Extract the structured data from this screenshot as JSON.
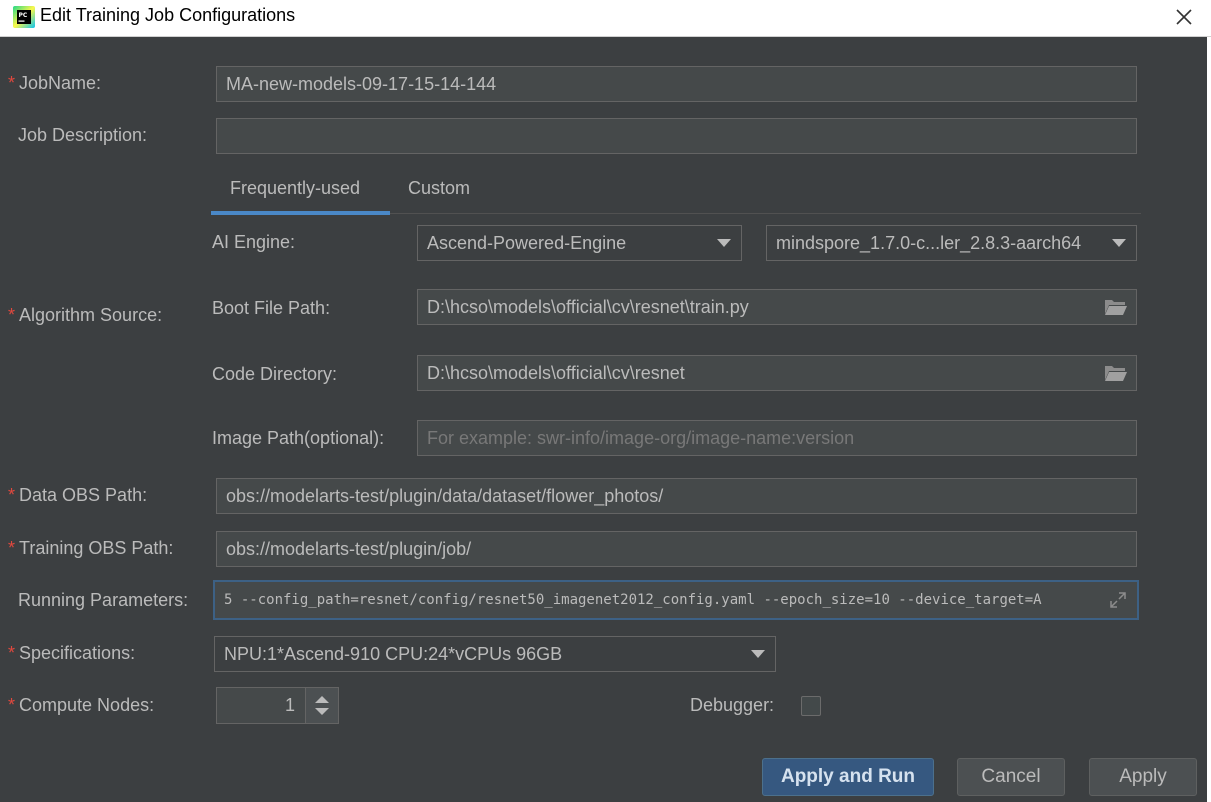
{
  "window": {
    "title": "Edit Training Job Configurations"
  },
  "form": {
    "jobname_label": "JobName:",
    "jobname_value": "MA-new-models-09-17-15-14-144",
    "job_description_label": "Job Description:",
    "job_description_value": "",
    "tabs": [
      {
        "label": "Frequently-used"
      },
      {
        "label": "Custom"
      }
    ],
    "ai_engine_label": "AI Engine:",
    "ai_engine_value": "Ascend-Powered-Engine",
    "engine_version_value": "mindspore_1.7.0-c...ler_2.8.3-aarch64",
    "algorithm_source_label": "Algorithm Source:",
    "boot_file_label": "Boot File Path:",
    "boot_file_value": "D:\\hcso\\models\\official\\cv\\resnet\\train.py",
    "code_dir_label": "Code Directory:",
    "code_dir_value": "D:\\hcso\\models\\official\\cv\\resnet",
    "image_path_label": "Image Path(optional):",
    "image_path_placeholder": "For example: swr-info/image-org/image-name:version",
    "data_obs_label": "Data OBS Path:",
    "data_obs_value": "obs://modelarts-test/plugin/data/dataset/flower_photos/",
    "training_obs_label": "Training OBS Path:",
    "training_obs_value": "obs://modelarts-test/plugin/job/",
    "running_params_label": "Running Parameters:",
    "running_params_value": "5 --config_path=resnet/config/resnet50_imagenet2012_config.yaml --epoch_size=10 --device_target=A",
    "specifications_label": "Specifications:",
    "specifications_value": "NPU:1*Ascend-910 CPU:24*vCPUs 96GB",
    "compute_nodes_label": "Compute Nodes:",
    "compute_nodes_value": "1",
    "debugger_label": "Debugger:",
    "required_marker": "*"
  },
  "buttons": {
    "apply_and_run": "Apply and Run",
    "cancel": "Cancel",
    "apply": "Apply"
  },
  "colors": {
    "background": "#3c3f41",
    "field": "#45494a",
    "accent": "#4a88c7",
    "primary_button": "#365880",
    "required": "#e0483e"
  },
  "icons": {
    "app": "pycharm-icon",
    "close": "close-icon",
    "folder": "folder-icon",
    "expand": "expand-icon"
  }
}
